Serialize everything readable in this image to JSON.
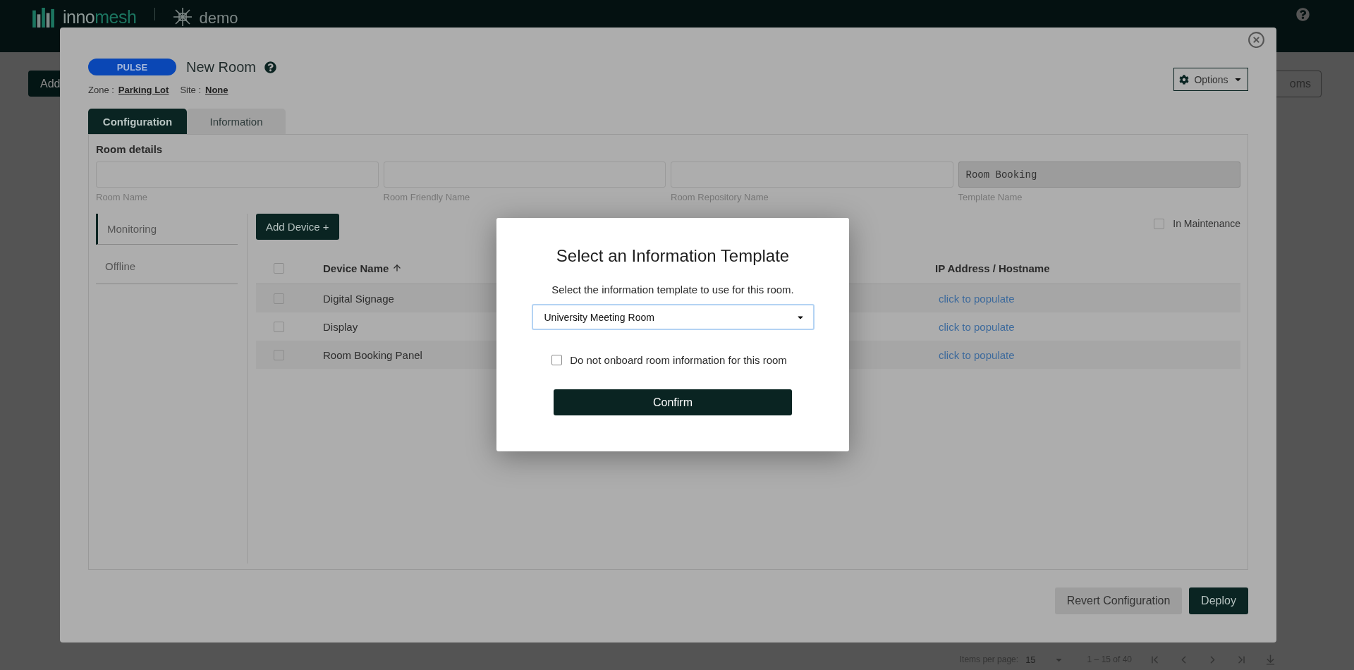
{
  "app_header": {
    "logo": {
      "prefix": "inno",
      "suffix": "mesh"
    },
    "tenant": "demo"
  },
  "page": {
    "add_button": "Add",
    "rooms_button": "oms",
    "paginator": {
      "items_per_page_label": "Items per page:",
      "items_per_page": "15",
      "range": "1 – 15 of 40"
    }
  },
  "room_modal": {
    "badge": "PULSE",
    "title": "New Room",
    "zone_label": "Zone :",
    "zone": "Parking Lot",
    "site_label": "Site :",
    "site": "None",
    "options_button": "Options",
    "tabs": [
      {
        "label": "Configuration",
        "selected": true
      },
      {
        "label": "Information",
        "selected": false
      }
    ],
    "section_title": "Room details",
    "fields": [
      {
        "label": "Room Name",
        "disabled": false
      },
      {
        "label": "Room Friendly Name",
        "disabled": false
      },
      {
        "label": "Room Repository Name",
        "disabled": false
      },
      {
        "label": "Template Name",
        "value": "Room Booking",
        "disabled": true
      }
    ],
    "nav": [
      {
        "label": "Monitoring",
        "selected": true
      },
      {
        "label": "Offline",
        "selected": false
      }
    ],
    "add_device_button": "Add Device +",
    "in_maintenance": {
      "label": "In Maintenance",
      "checked": false
    },
    "table": {
      "select_all_checked": false,
      "columns": [
        {
          "label": "Device Name",
          "sorted": true
        },
        {
          "label": "IP Address / Hostname",
          "sorted": false
        }
      ],
      "rows": [
        {
          "checked": false,
          "device_name": "Digital Signage",
          "ip": "click to populate"
        },
        {
          "checked": false,
          "device_name": "Display",
          "ip": "click to populate"
        },
        {
          "checked": false,
          "device_name": "Room Booking Panel",
          "ip": "click to populate"
        }
      ]
    },
    "footer_buttons": {
      "revert": "Revert Configuration",
      "deploy": "Deploy"
    }
  },
  "template_dialog": {
    "title": "Select an Information Template",
    "description": "Select the information template to use for this room.",
    "select_value": "University Meeting Room",
    "skip_option": {
      "label": "Do not onboard room information for this room",
      "checked": false
    },
    "confirm_button": "Confirm"
  }
}
